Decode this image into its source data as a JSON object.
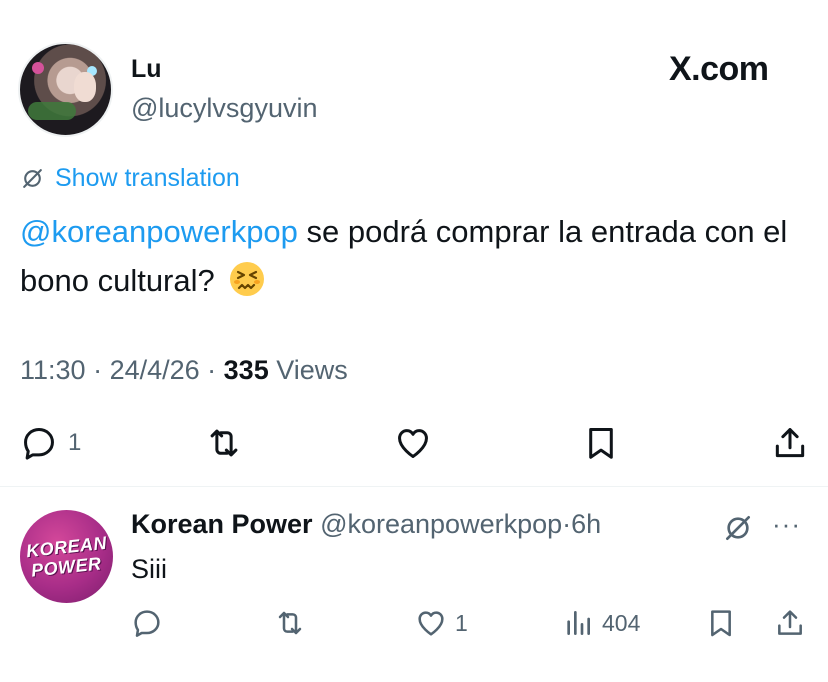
{
  "tweet": {
    "display_name": "Lu",
    "handle": "@lucylvsgyuvin",
    "site_logo": "X.com",
    "translate_label": "Show translation",
    "mention": "@koreanpowerkpop",
    "text": " se podrá comprar la entrada con el bono cultural?",
    "emoji": "confounded-face",
    "time": "11:30",
    "date": "24/4/26",
    "views_count": "335",
    "views_label": "Views",
    "reply_count": "1"
  },
  "reply": {
    "display_name": "Korean Power",
    "handle": "@koreanpowerkpop",
    "age": "6h",
    "text": "Siii",
    "avatar_text_line1": "KOREAN",
    "avatar_text_line2": "POWER",
    "like_count": "1",
    "views_count": "404",
    "more_glyph": "···"
  },
  "colors": {
    "link": "#1d9bf0",
    "muted": "#536471",
    "text": "#0f1419",
    "divider": "#eff3f4",
    "avatar_brand": "#a82d88"
  },
  "icons": [
    "comment-icon",
    "retweet-icon",
    "like-icon",
    "bookmark-icon",
    "share-icon",
    "views-icon",
    "translate-icon",
    "more-icon"
  ]
}
